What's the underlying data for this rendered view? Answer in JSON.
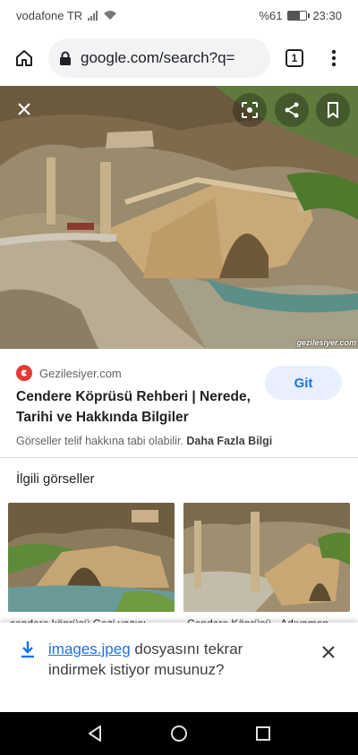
{
  "status": {
    "carrier": "vodafone TR",
    "battery_percent": "%61",
    "battery_level": 0.61,
    "time": "23:30"
  },
  "browser": {
    "url": "google.com/search?q=",
    "tab_count": "1",
    "icons": [
      "home-icon",
      "lock-icon",
      "tab-switcher-icon",
      "more-vert-icon"
    ]
  },
  "image_viewer": {
    "watermark": "gezilesiyer.com",
    "icons": [
      "close-icon",
      "lens-icon",
      "share-icon",
      "bookmark-icon"
    ]
  },
  "result": {
    "source": "Gezilesiyer.com",
    "title": "Cendere Köprüsü Rehberi | Nerede, Tarihi ve Hakkında Bilgiler",
    "visit_button": "Git",
    "copyright_notice": "Görseller telif hakkına tabi olabilir.",
    "more_info": "Daha Fazla Bilgi"
  },
  "related": {
    "heading": "İlgili görseller",
    "items": [
      {
        "caption": "cendere köprüsü Gezi yazısı"
      },
      {
        "caption": "Cendere Köprüsü - Adıyaman"
      }
    ]
  },
  "download_prompt": {
    "file_name": "images.jpeg",
    "message": " dosyasını tekrar indirmek istiyor musunuz?"
  },
  "colors": {
    "accent": "#1a73e8",
    "button_bg": "#e8f0fe",
    "favicon": "#e53935"
  }
}
